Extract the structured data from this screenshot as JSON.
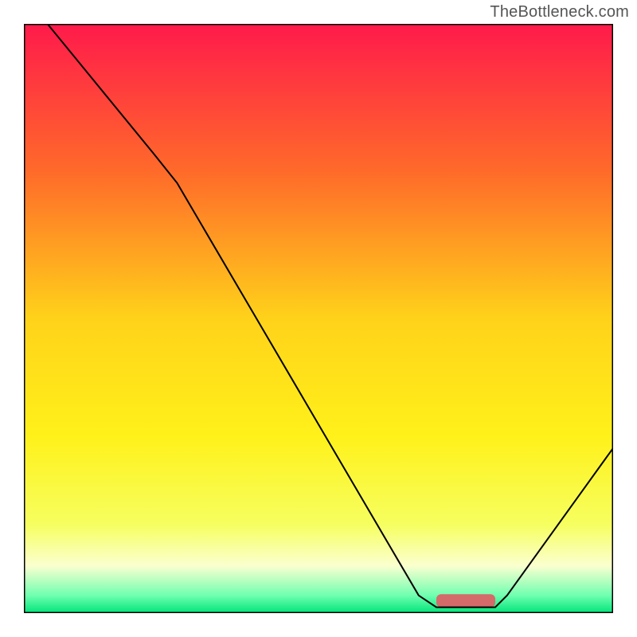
{
  "attribution": "TheBottleneck.com",
  "chart_data": {
    "type": "line",
    "title": "",
    "xlabel": "",
    "ylabel": "",
    "xlim": [
      0,
      100
    ],
    "ylim": [
      0,
      100
    ],
    "axes_visible": false,
    "grid": false,
    "gradient_background": {
      "stops": [
        {
          "offset": 0.0,
          "color": "#ff1a4b"
        },
        {
          "offset": 0.25,
          "color": "#ff6a2a"
        },
        {
          "offset": 0.5,
          "color": "#ffd21a"
        },
        {
          "offset": 0.7,
          "color": "#fff11a"
        },
        {
          "offset": 0.85,
          "color": "#f6ff60"
        },
        {
          "offset": 0.92,
          "color": "#fbffd0"
        },
        {
          "offset": 0.97,
          "color": "#70ffb0"
        },
        {
          "offset": 1.0,
          "color": "#00e47a"
        }
      ]
    },
    "curve": [
      {
        "x": 4,
        "y": 100
      },
      {
        "x": 22,
        "y": 78
      },
      {
        "x": 26,
        "y": 73
      },
      {
        "x": 67,
        "y": 3
      },
      {
        "x": 70,
        "y": 1
      },
      {
        "x": 80,
        "y": 1
      },
      {
        "x": 82,
        "y": 3
      },
      {
        "x": 100,
        "y": 28
      }
    ],
    "marker": {
      "shape": "rounded-rect",
      "x": 70,
      "y": 1,
      "width": 10,
      "height": 2.2,
      "fill": "#d56a6a"
    },
    "frame_color": "#000000",
    "curve_color": "#000000",
    "curve_width": 2
  }
}
